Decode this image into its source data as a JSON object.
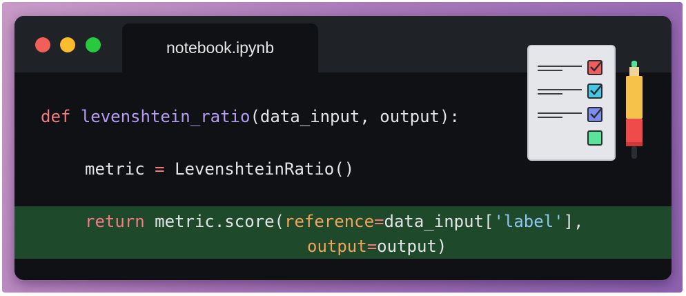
{
  "window": {
    "tab_title": "notebook.ipynb"
  },
  "code": {
    "line1": {
      "kw": "def",
      "fn": "levenshtein_ratio",
      "rest": "(data_input, output):"
    },
    "line2": {
      "lhs": "metric",
      "op": "=",
      "rhs": "LevenshteinRatio()"
    },
    "line3": {
      "kw": "return",
      "mid": "metric.score(",
      "param1": "reference",
      "eq1": "=",
      "arg1": "data_input[",
      "str": "'label'",
      "tail": "],"
    },
    "line4": {
      "param2": "output",
      "eq2": "=",
      "arg2": "output)"
    }
  },
  "colors": {
    "keyword": "#f47a82",
    "function": "#b59cf0",
    "parameter": "#f2a35c",
    "string": "#8ec7f0",
    "highlight": "#1e4a2b"
  },
  "illustration": {
    "icons": [
      "checklist-clipboard-icon",
      "highlighter-pen-icon"
    ]
  }
}
